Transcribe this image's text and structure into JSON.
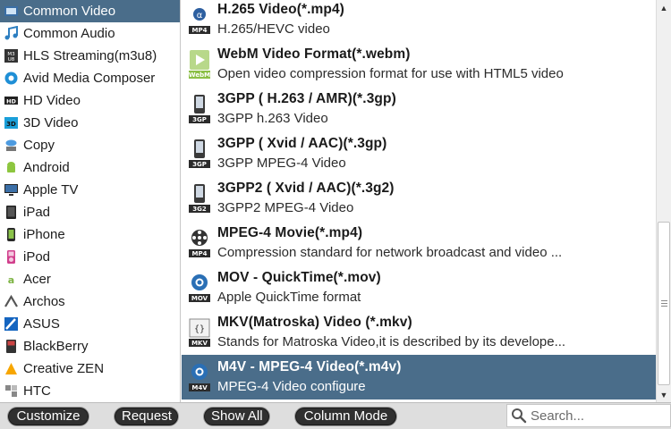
{
  "categories": [
    {
      "label": "Common Video",
      "icon": "film-icon",
      "selected": true
    },
    {
      "label": "Common Audio",
      "icon": "music-note-icon"
    },
    {
      "label": "HLS Streaming(m3u8)",
      "icon": "m3u8-icon"
    },
    {
      "label": "Avid Media Composer",
      "icon": "avid-icon"
    },
    {
      "label": "HD Video",
      "icon": "hd-icon"
    },
    {
      "label": "3D Video",
      "icon": "3d-icon"
    },
    {
      "label": "Copy",
      "icon": "copy-icon"
    },
    {
      "label": "Android",
      "icon": "android-icon"
    },
    {
      "label": "Apple TV",
      "icon": "apple-tv-icon"
    },
    {
      "label": "iPad",
      "icon": "ipad-icon"
    },
    {
      "label": "iPhone",
      "icon": "iphone-icon"
    },
    {
      "label": "iPod",
      "icon": "ipod-icon"
    },
    {
      "label": "Acer",
      "icon": "acer-icon"
    },
    {
      "label": "Archos",
      "icon": "archos-icon"
    },
    {
      "label": "ASUS",
      "icon": "asus-icon"
    },
    {
      "label": "BlackBerry",
      "icon": "blackberry-icon"
    },
    {
      "label": "Creative ZEN",
      "icon": "creative-zen-icon"
    },
    {
      "label": "HTC",
      "icon": "htc-icon"
    }
  ],
  "formats": [
    {
      "title": "H.265 Video(*.mp4)",
      "desc": "H.265/HEVC video",
      "icon": "mp4-icon",
      "badge": "MP4"
    },
    {
      "title": "WebM Video Format(*.webm)",
      "desc": "Open video compression format for use with HTML5 video",
      "icon": "webm-icon",
      "badge": "WebM"
    },
    {
      "title": "3GPP ( H.263 / AMR)(*.3gp)",
      "desc": "3GPP h.263 Video",
      "icon": "3gp-icon",
      "badge": "3GP"
    },
    {
      "title": "3GPP ( Xvid / AAC)(*.3gp)",
      "desc": "3GPP MPEG-4 Video",
      "icon": "3gp-icon",
      "badge": "3GP"
    },
    {
      "title": "3GPP2 ( Xvid / AAC)(*.3g2)",
      "desc": "3GPP2 MPEG-4 Video",
      "icon": "3g2-icon",
      "badge": "3G2"
    },
    {
      "title": "MPEG-4 Movie(*.mp4)",
      "desc": "Compression standard for network broadcast and video ...",
      "icon": "mp4-reel-icon",
      "badge": "MP4"
    },
    {
      "title": "MOV - QuickTime(*.mov)",
      "desc": "Apple QuickTime format",
      "icon": "mov-icon",
      "badge": "MOV"
    },
    {
      "title": "MKV(Matroska) Video (*.mkv)",
      "desc": "Stands for Matroska Video,it is described by its develope...",
      "icon": "mkv-icon",
      "badge": "MKV"
    },
    {
      "title": "M4V - MPEG-4 Video(*.m4v)",
      "desc": "MPEG-4 Video configure",
      "icon": "m4v-icon",
      "badge": "M4V",
      "selected": true
    }
  ],
  "toolbar": {
    "customize_label": "Customize",
    "request_label": "Request",
    "show_all_label": "Show All",
    "column_mode_label": "Column Mode"
  },
  "search": {
    "placeholder": "Search...",
    "value": ""
  },
  "scrollbar": {
    "up": "▲",
    "down": "▼"
  },
  "colors": {
    "selection": "#4a6d8a",
    "button_bg": "#303030",
    "bottom_bar": "#dedede"
  }
}
